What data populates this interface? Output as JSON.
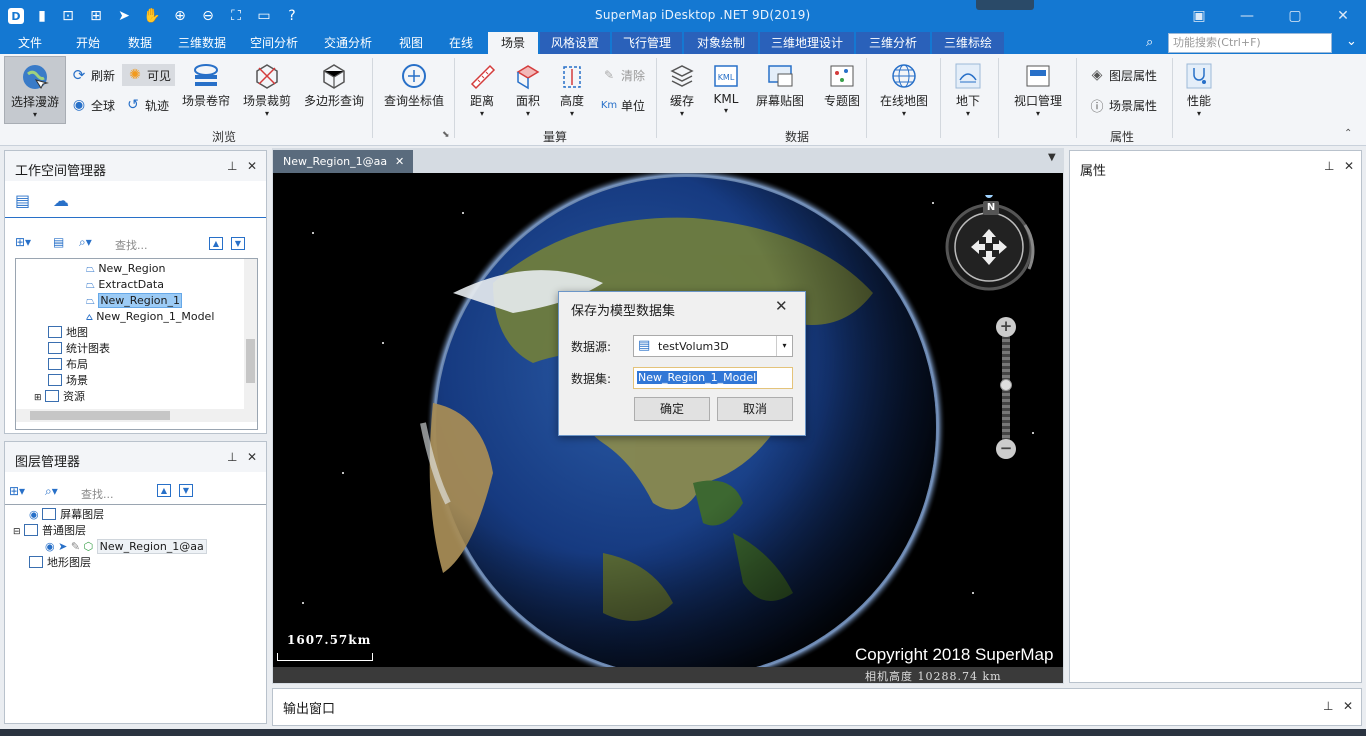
{
  "app": {
    "title": "SuperMap iDesktop .NET 9D(2019)"
  },
  "menu": {
    "tabs": [
      {
        "label": "文件"
      },
      {
        "label": "开始"
      },
      {
        "label": "数据"
      },
      {
        "label": "三维数据"
      },
      {
        "label": "空间分析"
      },
      {
        "label": "交通分析"
      },
      {
        "label": "视图"
      },
      {
        "label": "在线"
      },
      {
        "label": "场景"
      },
      {
        "label": "风格设置"
      },
      {
        "label": "飞行管理"
      },
      {
        "label": "对象绘制"
      },
      {
        "label": "三维地理设计"
      },
      {
        "label": "三维分析"
      },
      {
        "label": "三维标绘"
      }
    ],
    "search_placeholder": "功能搜索(Ctrl+F)"
  },
  "ribbon": {
    "browse": {
      "select_roam": "选择漫游",
      "refresh": "刷新",
      "visible": "可见",
      "globe": "全球",
      "track": "轨迹",
      "scene_roll": "场景卷帘",
      "scene_clip": "场景裁剪",
      "polygon_query": "多边形查询",
      "query_coord": "查询坐标值",
      "group": "浏览"
    },
    "measure": {
      "distance": "距离",
      "area": "面积",
      "height": "高度",
      "clear": "清除",
      "unit": "单位",
      "group": "量算"
    },
    "data": {
      "cache": "缓存",
      "kml": "KML",
      "screen_tile": "屏幕贴图",
      "thematic": "专题图",
      "online_map": "在线地图",
      "underground": "地下",
      "group": "数据"
    },
    "view": {
      "viewport": "视口管理"
    },
    "props": {
      "layer_props": "图层属性",
      "scene_props": "场景属性",
      "group": "属性"
    },
    "perf": {
      "performance": "性能"
    }
  },
  "workspace": {
    "title": "工作空间管理器",
    "search_placeholder": "查找...",
    "items": [
      {
        "label": "New_Region"
      },
      {
        "label": "ExtractData"
      },
      {
        "label": "New_Region_1"
      },
      {
        "label": "New_Region_1_Model"
      },
      {
        "label": "地图"
      },
      {
        "label": "统计图表"
      },
      {
        "label": "布局"
      },
      {
        "label": "场景"
      },
      {
        "label": "资源"
      }
    ]
  },
  "layers": {
    "title": "图层管理器",
    "search_placeholder": "查找...",
    "items": [
      {
        "label": "屏幕图层"
      },
      {
        "label": "普通图层"
      },
      {
        "label": "New_Region_1@aa"
      },
      {
        "label": "地形图层"
      }
    ]
  },
  "document": {
    "tab": "New_Region_1@aa"
  },
  "scene": {
    "scale_label": "1607.57km",
    "copyright": "Copyright 2018 SuperMap",
    "camera_height": "相机高度 10288.74 km",
    "compass_n": "N"
  },
  "dialog": {
    "title": "保存为模型数据集",
    "datasource_label": "数据源:",
    "datasource_value": "testVolum3D",
    "dataset_label": "数据集:",
    "dataset_value": "New_Region_1_Model",
    "ok": "确定",
    "cancel": "取消"
  },
  "properties": {
    "title": "属性"
  },
  "output": {
    "title": "输出窗口"
  },
  "colors": {
    "accent": "#1478d2",
    "ribbon_bg": "#f3f5f8",
    "space": "#000000"
  }
}
